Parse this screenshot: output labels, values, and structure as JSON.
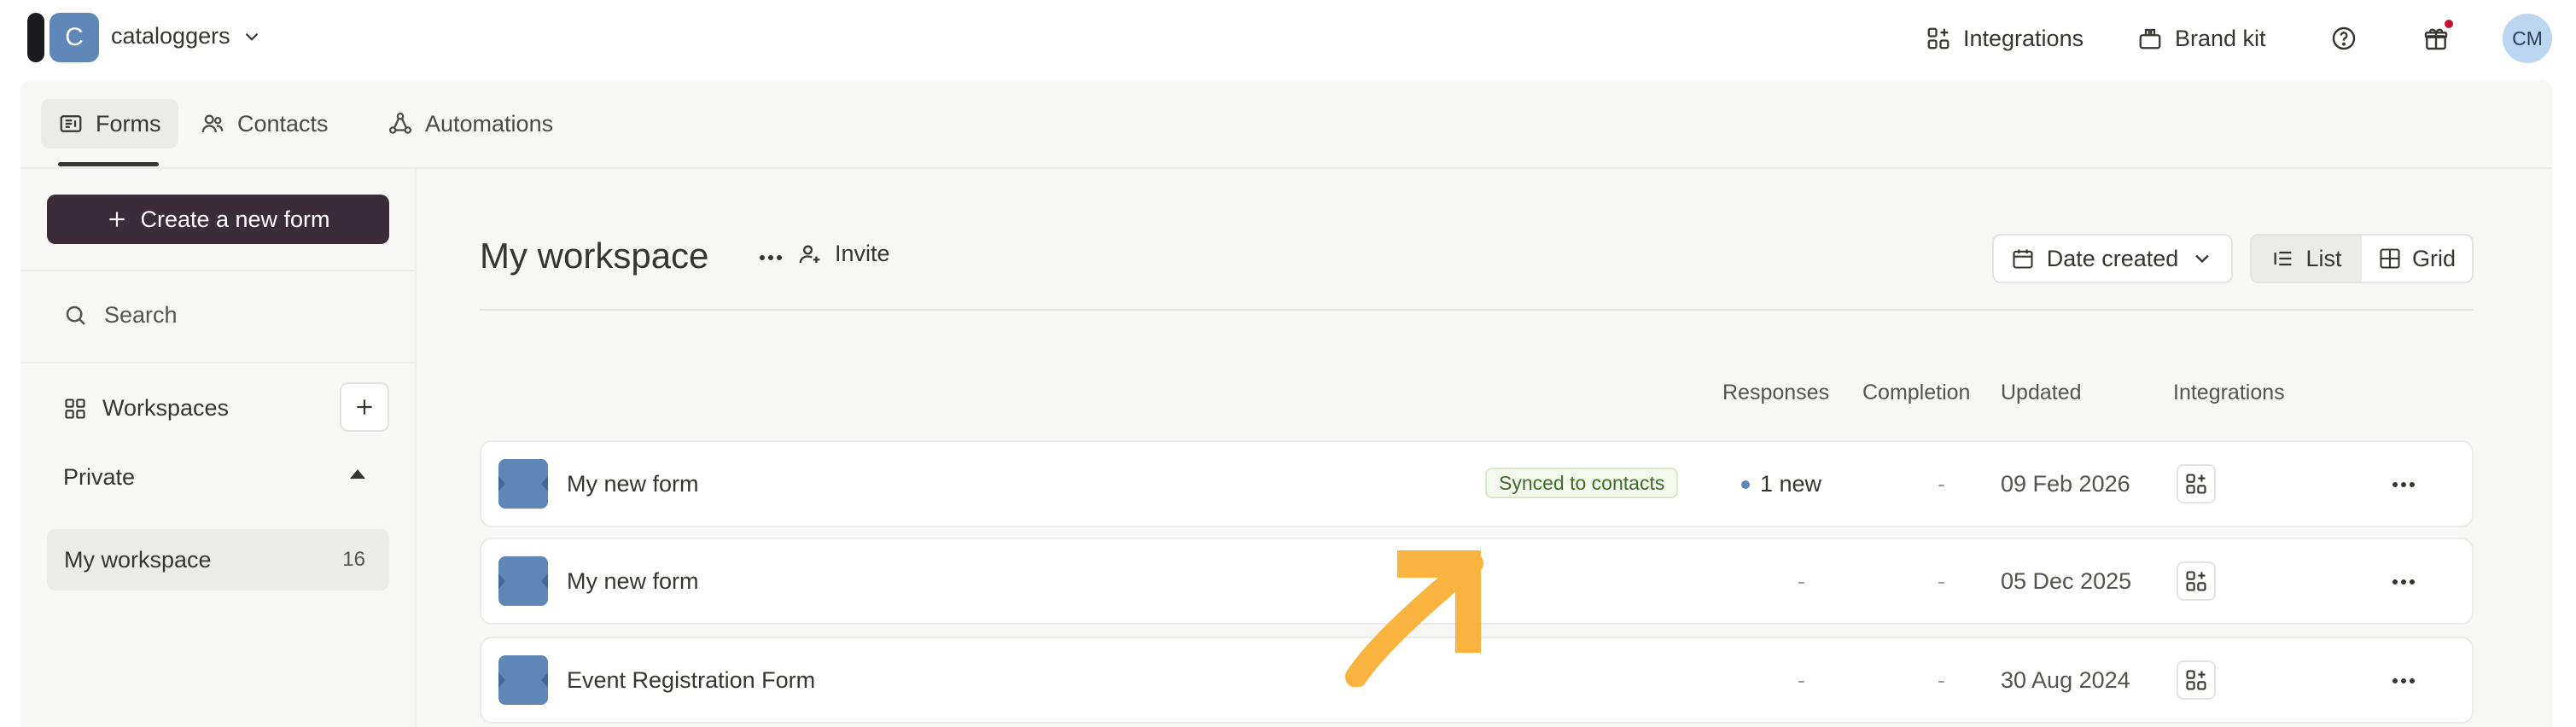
{
  "topbar": {
    "workspace_initial": "C",
    "workspace_name": "cataloggers",
    "integrations_label": "Integrations",
    "brand_kit_label": "Brand kit",
    "user_initials": "CM"
  },
  "tabs": [
    {
      "label": "Forms",
      "icon": "forms-icon",
      "active": true
    },
    {
      "label": "Contacts",
      "icon": "contacts-icon",
      "active": false
    },
    {
      "label": "Automations",
      "icon": "automations-icon",
      "active": false
    }
  ],
  "sidebar": {
    "create_label": "Create a new form",
    "search_label": "Search",
    "workspaces_label": "Workspaces",
    "private_label": "Private",
    "workspace_items": [
      {
        "label": "My workspace",
        "count": "16"
      }
    ]
  },
  "main": {
    "title": "My workspace",
    "invite_label": "Invite",
    "sort_label": "Date created",
    "view_list_label": "List",
    "view_grid_label": "Grid",
    "columns": {
      "responses": "Responses",
      "completion": "Completion",
      "updated": "Updated",
      "integrations": "Integrations"
    },
    "forms": [
      {
        "name": "My new form",
        "badge": "Synced to contacts",
        "responses": "1 new",
        "completion": "-",
        "updated": "09 Feb 2026"
      },
      {
        "name": "My new form",
        "badge": "",
        "responses": "-",
        "completion": "-",
        "updated": "05 Dec 2025"
      },
      {
        "name": "Event Registration Form",
        "badge": "",
        "responses": "-",
        "completion": "-",
        "updated": "30 Aug 2024"
      }
    ]
  },
  "colors": {
    "accent_dark": "#3b2c3a",
    "thumb_blue": "#5e86b6",
    "annotation_arrow": "#fbb33f",
    "badge_green": "#3d6b2a"
  }
}
